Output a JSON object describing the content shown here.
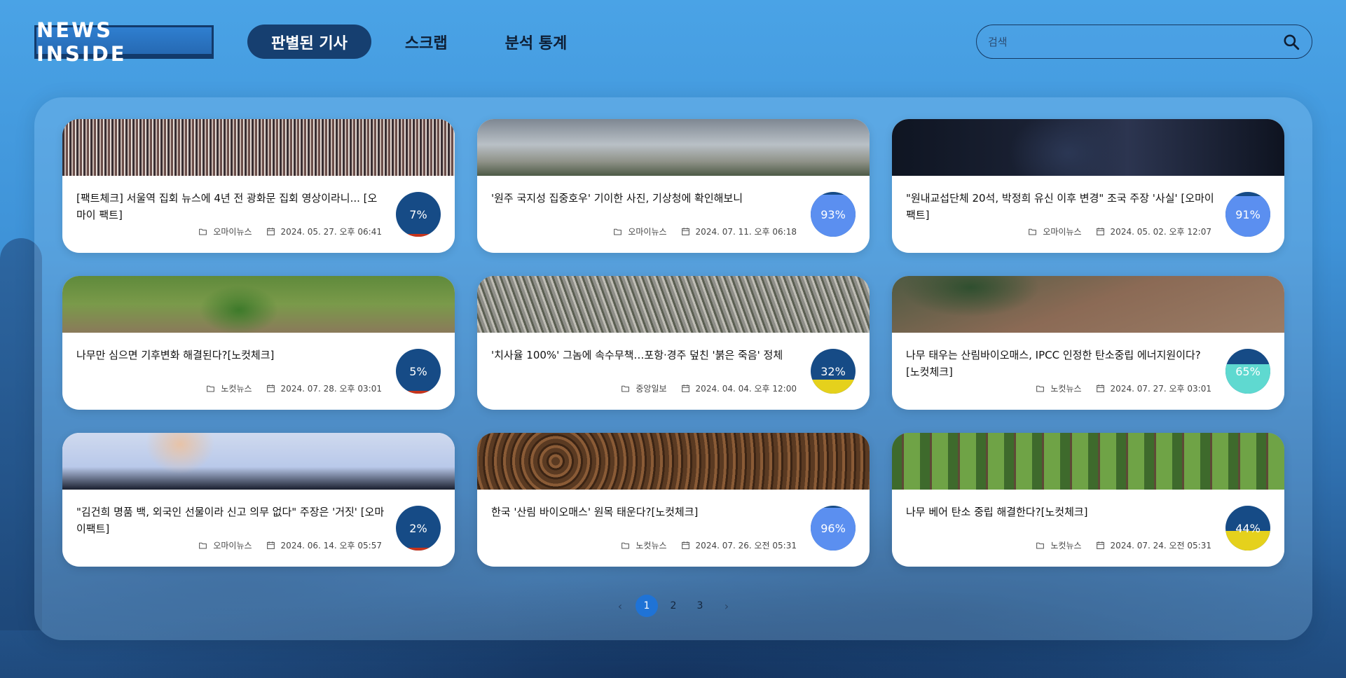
{
  "brand": {
    "logo_text": "NEWS INSIDE"
  },
  "nav": {
    "tabs": [
      {
        "label": "판별된 기사",
        "active": true
      },
      {
        "label": "스크랩",
        "active": false
      },
      {
        "label": "분석 통계",
        "active": false
      }
    ]
  },
  "search": {
    "placeholder": "검색",
    "value": ""
  },
  "articles": [
    {
      "title": "[팩트체크] 서울역 집회 뉴스에 4년 전 광화문 집회 영상이라니... [오마이 팩트]",
      "source": "오마이뉴스",
      "date": "2024. 05. 27. 오후 06:41",
      "score_label": "7%",
      "score": 7,
      "fill_color": "#c8341b",
      "image": "crowd"
    },
    {
      "title": "'원주 국지성 집중호우' 기이한 사진, 기상청에 확인해보니",
      "source": "오마이뉴스",
      "date": "2024. 07. 11. 오후 06:18",
      "score_label": "93%",
      "score": 93,
      "fill_color": "#5b8ff0",
      "image": "rain"
    },
    {
      "title": "\"원내교섭단체 20석, 박정희 유신 이후 변경\" 조국 주장 '사실' [오마이 팩트]",
      "source": "오마이뉴스",
      "date": "2024. 05. 02. 오후 12:07",
      "score_label": "91%",
      "score": 91,
      "fill_color": "#5b8ff0",
      "image": "suit"
    },
    {
      "title": "나무만 심으면 기후변화 해결된다?[노컷체크]",
      "source": "노컷뉴스",
      "date": "2024. 07. 28. 오후 03:01",
      "score_label": "5%",
      "score": 5,
      "fill_color": "#c8341b",
      "image": "sapling"
    },
    {
      "title": "'치사율 100%' 그놈에 속수무책…포항·경주 덮친 '붉은 죽음' 정체",
      "source": "중앙일보",
      "date": "2024. 04. 04. 오후 12:00",
      "score_label": "32%",
      "score": 32,
      "fill_color": "#e5d11c",
      "image": "dead-forest"
    },
    {
      "title": "나무 태우는 산림바이오매스, IPCC 인정한 탄소중립 에너지원이다?[노컷체크]",
      "source": "노컷뉴스",
      "date": "2024. 07. 27. 오후 03:01",
      "score_label": "65%",
      "score": 65,
      "fill_color": "#5fd9d0",
      "image": "clearcut"
    },
    {
      "title": "\"김건희 명품 백, 외국인 선물이라 신고 의무 없다\" 주장은 '거짓' [오마이팩트]",
      "source": "오마이뉴스",
      "date": "2024. 06. 14. 오후 05:57",
      "score_label": "2%",
      "score": 2,
      "fill_color": "#c8341b",
      "image": "portrait"
    },
    {
      "title": "한국 '산림 바이오매스' 원목 태운다?[노컷체크]",
      "source": "노컷뉴스",
      "date": "2024. 07. 26. 오전 05:31",
      "score_label": "96%",
      "score": 96,
      "fill_color": "#5b8ff0",
      "image": "logs"
    },
    {
      "title": "나무 베어 탄소 중립 해결한다?[노컷체크]",
      "source": "노컷뉴스",
      "date": "2024. 07. 24. 오전 05:31",
      "score_label": "44%",
      "score": 44,
      "fill_color": "#e5d11c",
      "image": "green-forest"
    }
  ],
  "pagination": {
    "prev_label": "‹",
    "next_label": "›",
    "pages": [
      "1",
      "2",
      "3"
    ],
    "current": "1"
  },
  "colors": {
    "nav_active_bg": "#163f70",
    "gauge_base": "#164b86",
    "page_active": "#1f73d6",
    "true_color": "#5b8ff0",
    "false_color": "#c8341b",
    "mixed_color": "#e5d11c"
  },
  "icons": {
    "search": "search-icon",
    "source": "folder-icon",
    "date": "calendar-icon"
  }
}
